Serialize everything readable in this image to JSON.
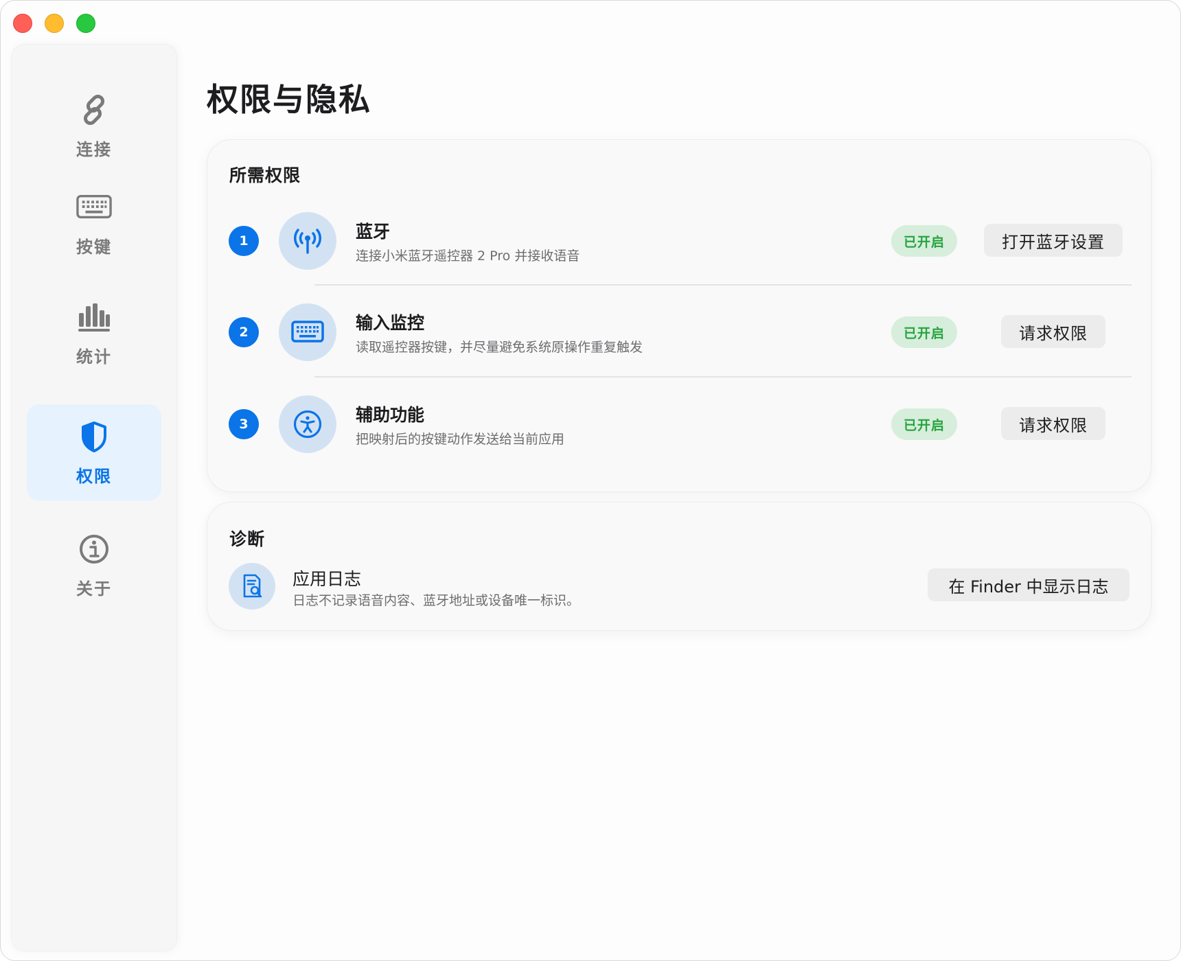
{
  "window": {
    "controls": {
      "close_color": "#ff5f57",
      "minimize_color": "#febc2e",
      "zoom_color": "#28c840"
    }
  },
  "sidebar": {
    "items": [
      {
        "label": "连接",
        "icon": "link-icon",
        "active": false
      },
      {
        "label": "按键",
        "icon": "keyboard-icon",
        "active": false
      },
      {
        "label": "统计",
        "icon": "chart-bar-icon",
        "active": false
      },
      {
        "label": "权限",
        "icon": "shield-icon",
        "active": true
      },
      {
        "label": "关于",
        "icon": "info-icon",
        "active": false
      }
    ]
  },
  "page": {
    "title": "权限与隐私"
  },
  "permissions": {
    "section_title": "所需权限",
    "rows": [
      {
        "step": "1",
        "icon": "antenna-icon",
        "title": "蓝牙",
        "description": "连接小米蓝牙遥控器 2 Pro 并接收语音",
        "status": "已开启",
        "action": "打开蓝牙设置"
      },
      {
        "step": "2",
        "icon": "keyboard-icon",
        "title": "输入监控",
        "description": "读取遥控器按键，并尽量避免系统原操作重复触发",
        "status": "已开启",
        "action": "请求权限"
      },
      {
        "step": "3",
        "icon": "accessibility-icon",
        "title": "辅助功能",
        "description": "把映射后的按键动作发送给当前应用",
        "status": "已开启",
        "action": "请求权限"
      }
    ]
  },
  "diagnostics": {
    "section_title": "诊断",
    "log": {
      "icon": "document-search-icon",
      "title": "应用日志",
      "description": "日志不记录语音内容、蓝牙地址或设备唯一标识。",
      "action": "在 Finder 中显示日志"
    }
  },
  "colors": {
    "accent": "#0a74e8",
    "status_bg": "#d6eedb",
    "status_text": "#26a33f",
    "icon_circle": "#d3e2f3",
    "active_nav_bg": "#e6f2fe"
  }
}
